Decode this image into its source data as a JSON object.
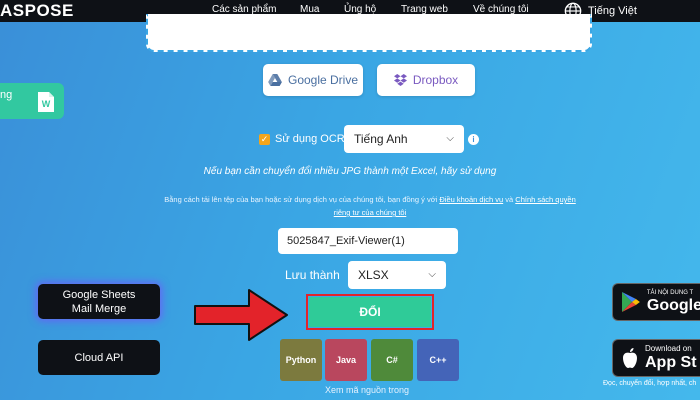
{
  "header": {
    "logo": "ASPOSE",
    "nav": [
      "Các sản phẩm",
      "Mua",
      "Ủng hộ",
      "Trang web",
      "Về chúng tôi"
    ],
    "language": "Tiếng Việt"
  },
  "upload_sources": {
    "google_drive": "Google Drive",
    "dropbox": "Dropbox"
  },
  "left_card": {
    "label": "ng"
  },
  "ocr": {
    "label": "Sử dụng OCR",
    "checked": true,
    "language_selected": "Tiếng Anh"
  },
  "hint_text": "Nếu bạn cần chuyển đổi nhiều JPG thành một Excel, hãy sử dụng",
  "terms": {
    "prefix": "Bằng cách tải lên tệp của bạn hoặc sử dụng dịch vụ của chúng tôi, bạn đồng ý với",
    "terms_link": "Điều khoản dịch vụ",
    "and": "và",
    "privacy_link": "Chính sách quyền riêng tư của chúng tôi"
  },
  "output": {
    "filename": "5025847_Exif-Viewer(1)",
    "save_as_label": "Lưu thành",
    "format_selected": "XLSX"
  },
  "convert_button": "ĐỔI",
  "side_buttons": {
    "sheets_line1": "Google Sheets",
    "sheets_line2": "Mail Merge",
    "cloud_api": "Cloud API"
  },
  "code_langs": [
    {
      "label": "Python",
      "color": "#7c7a3e"
    },
    {
      "label": "Java",
      "color": "#b9475e"
    },
    {
      "label": "C#",
      "color": "#4f8a3a"
    },
    {
      "label": "C++",
      "color": "#4464b8"
    }
  ],
  "source_link": "Xem mã nguồn trong",
  "stores": {
    "google_small": "TẢI NỘI DUNG T",
    "google_big": "Google",
    "apple_small": "Download on",
    "apple_big": "App St",
    "caption": "Đọc, chuyển đổi, hợp nhất, ch"
  },
  "colors": {
    "convert": "#2fcb98",
    "highlight": "#e3232a",
    "arrow": "#e3232a",
    "checkbox": "#f4a51c"
  }
}
